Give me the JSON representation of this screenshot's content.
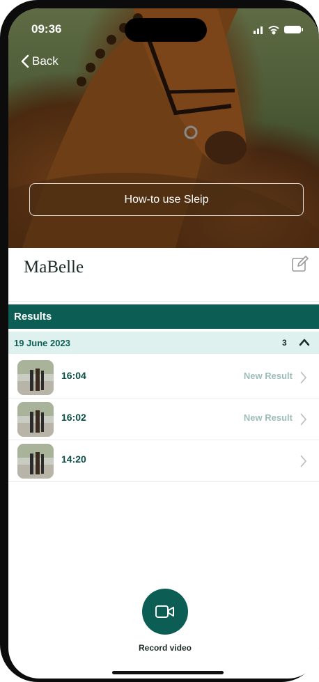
{
  "status_bar": {
    "time": "09:36"
  },
  "nav": {
    "back_label": "Back"
  },
  "hero": {
    "howto_label": "How-to use Sleip"
  },
  "horse": {
    "name": "MaBelle"
  },
  "results": {
    "header": "Results",
    "groups": [
      {
        "date": "19 June 2023",
        "count": "3",
        "items": [
          {
            "time": "16:04",
            "status": "New Result"
          },
          {
            "time": "16:02",
            "status": "New Result"
          },
          {
            "time": "14:20",
            "status": ""
          }
        ]
      }
    ]
  },
  "actions": {
    "record_label": "Record video"
  },
  "colors": {
    "accent": "#0c5e55",
    "date_bg": "#dff1ee",
    "status_text": "#9dbdb6"
  },
  "icons": [
    "back-chevron-icon",
    "signal-icon",
    "wifi-icon",
    "battery-icon",
    "edit-icon",
    "collapse-chevron-icon",
    "row-chevron-icon",
    "video-camera-icon"
  ]
}
